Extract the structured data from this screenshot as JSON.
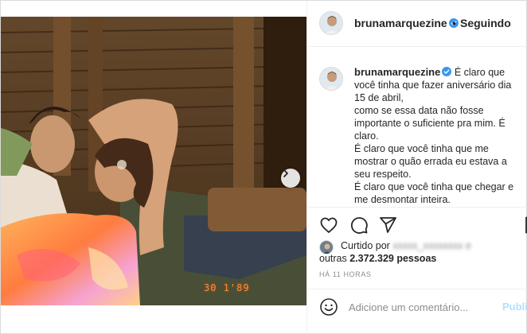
{
  "photo": {
    "date_stamp": "30  1'89",
    "carousel_dots": 6,
    "active_dot": 0,
    "icons": {
      "next": "chevron-right-icon"
    }
  },
  "header": {
    "username": "brunamarquezine",
    "separator": "•",
    "follow_status": "Seguindo"
  },
  "caption": {
    "username": "brunamarquezine",
    "lines": [
      "É claro que você tinha que fazer aniversário dia 15 de abril,",
      "como se essa data não fosse importante o suficiente pra mim. É claro.",
      "É claro que você tinha que me mostrar o quão errada eu estava a seu respeito.",
      "É claro que você tinha que chegar e me desmontar inteira."
    ]
  },
  "actions": {
    "icons": [
      "heart-icon",
      "comment-icon",
      "share-icon",
      "bookmark-icon"
    ]
  },
  "likes": {
    "prefix": "Curtido por",
    "blurred_name": "xxxxx_xxxxxxxx e",
    "others_prefix": "outras",
    "count": "2.372.329 pessoas"
  },
  "timestamp": "HÁ 11 HORAS",
  "comment_box": {
    "placeholder": "Adicione um comentário...",
    "publish_label": "Publicar"
  },
  "colors": {
    "verified_blue": "#3897f0",
    "link_blue": "#0095f6",
    "publish_disabled": "#b2dffc",
    "muted_text": "#8e8e8e"
  }
}
